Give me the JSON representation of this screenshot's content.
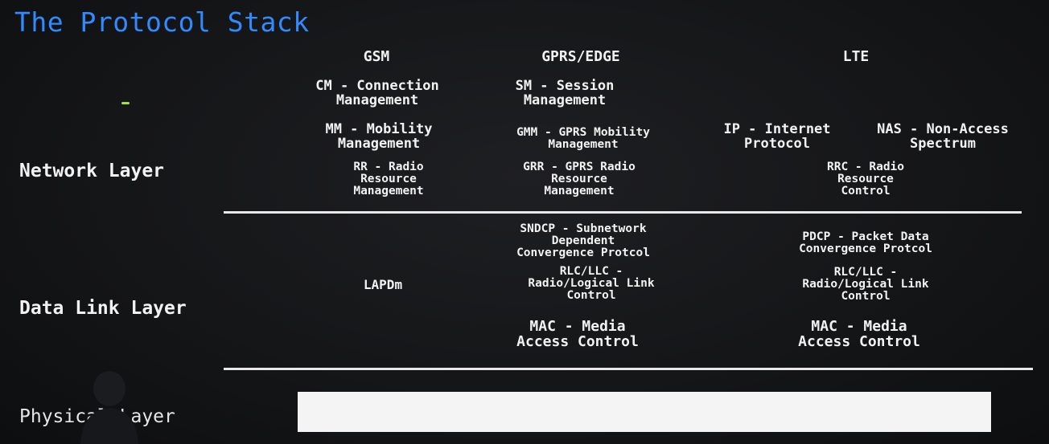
{
  "title": "The Protocol Stack",
  "layers": {
    "network": "Network Layer",
    "data_link": "Data Link Layer",
    "physical": "Physical Layer"
  },
  "columns": {
    "gsm": "GSM",
    "gprs": "GPRS/EDGE",
    "lte": "LTE"
  },
  "network": {
    "gsm": [
      "CM - Connection\nManagement",
      "MM - Mobility\nManagement",
      "RR - Radio\nResource\nManagement"
    ],
    "gprs": [
      "SM - Session\nManagement",
      "GMM - GPRS Mobility\nManagement",
      "GRR - GPRS Radio\nResource\nManagement"
    ],
    "lte": [
      "IP - Internet\nProtocol",
      "NAS - Non-Access\nSpectrum",
      "RRC - Radio\nResource\nControl"
    ]
  },
  "data_link": {
    "gsm": [
      "LAPDm"
    ],
    "gprs": [
      "SNDCP - Subnetwork\nDependent\nConvergence Protcol",
      "RLC/LLC -\nRadio/Logical Link\nControl",
      "MAC - Media\nAccess Control"
    ],
    "lte": [
      "PDCP - Packet Data\nConvergence Protcol",
      "RLC/LLC -\nRadio/Logical Link\nControl",
      "MAC - Media\nAccess Control"
    ]
  },
  "colors": {
    "title": "#2f8bff",
    "text": "#f2f2f2",
    "background": "#151618",
    "divider": "#e8e8e8",
    "physical_bar": "#f4f4f4",
    "marker": "#a6e22e"
  }
}
